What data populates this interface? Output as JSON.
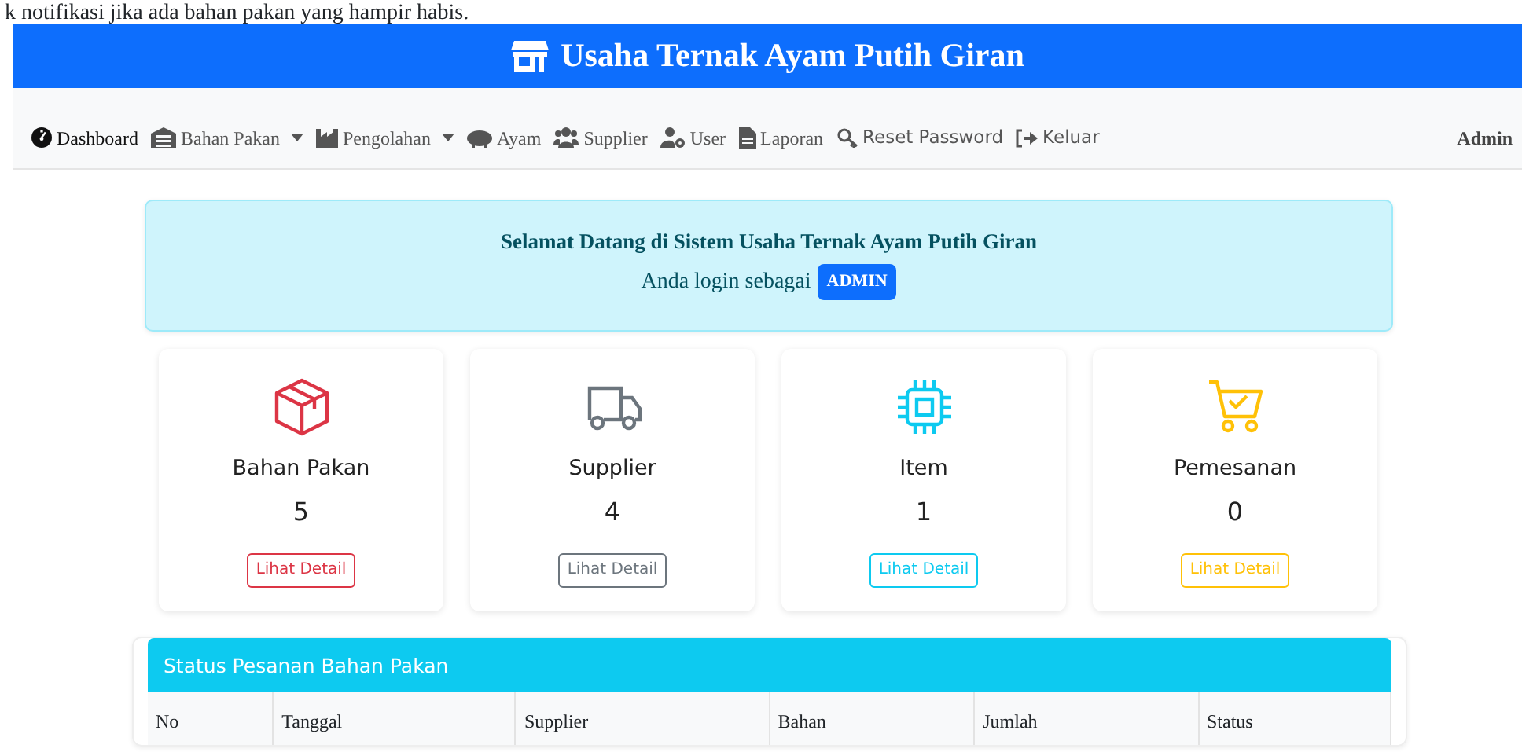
{
  "top_note": "k notifikasi jika ada bahan pakan yang hampir habis.",
  "header": {
    "title": "Usaha Ternak Ayam Putih Giran"
  },
  "nav": {
    "items": [
      {
        "label": "Dashboard",
        "selected": true,
        "dropdown": false,
        "kind": "serif"
      },
      {
        "label": "Bahan Pakan",
        "selected": false,
        "dropdown": true,
        "kind": "serif"
      },
      {
        "label": "Pengolahan",
        "selected": false,
        "dropdown": true,
        "kind": "serif"
      },
      {
        "label": "Ayam",
        "selected": false,
        "dropdown": false,
        "kind": "serif"
      },
      {
        "label": "Supplier",
        "selected": false,
        "dropdown": false,
        "kind": "serif"
      },
      {
        "label": "User",
        "selected": false,
        "dropdown": false,
        "kind": "serif"
      },
      {
        "label": "Laporan",
        "selected": false,
        "dropdown": false,
        "kind": "serif"
      },
      {
        "label": "Reset Password",
        "selected": false,
        "dropdown": false,
        "kind": "sans"
      },
      {
        "label": "Keluar",
        "selected": false,
        "dropdown": false,
        "kind": "sans"
      }
    ],
    "user": "Admin"
  },
  "welcome": {
    "title": "Selamat Datang di Sistem Usaha Ternak Ayam Putih Giran",
    "text": "Anda login sebagai",
    "role": "ADMIN"
  },
  "cards": [
    {
      "label": "Bahan Pakan",
      "count": "5",
      "button": "Lihat Detail",
      "color": "#dc3545"
    },
    {
      "label": "Supplier",
      "count": "4",
      "button": "Lihat Detail",
      "color": "#6c757d"
    },
    {
      "label": "Item",
      "count": "1",
      "button": "Lihat Detail",
      "color": "#0dcaf0"
    },
    {
      "label": "Pemesanan",
      "count": "0",
      "button": "Lihat Detail",
      "color": "#ffc107"
    }
  ],
  "orders": {
    "title": "Status Pesanan Bahan Pakan",
    "columns": [
      "No",
      "Tanggal",
      "Supplier",
      "Bahan",
      "Jumlah",
      "Status"
    ]
  }
}
